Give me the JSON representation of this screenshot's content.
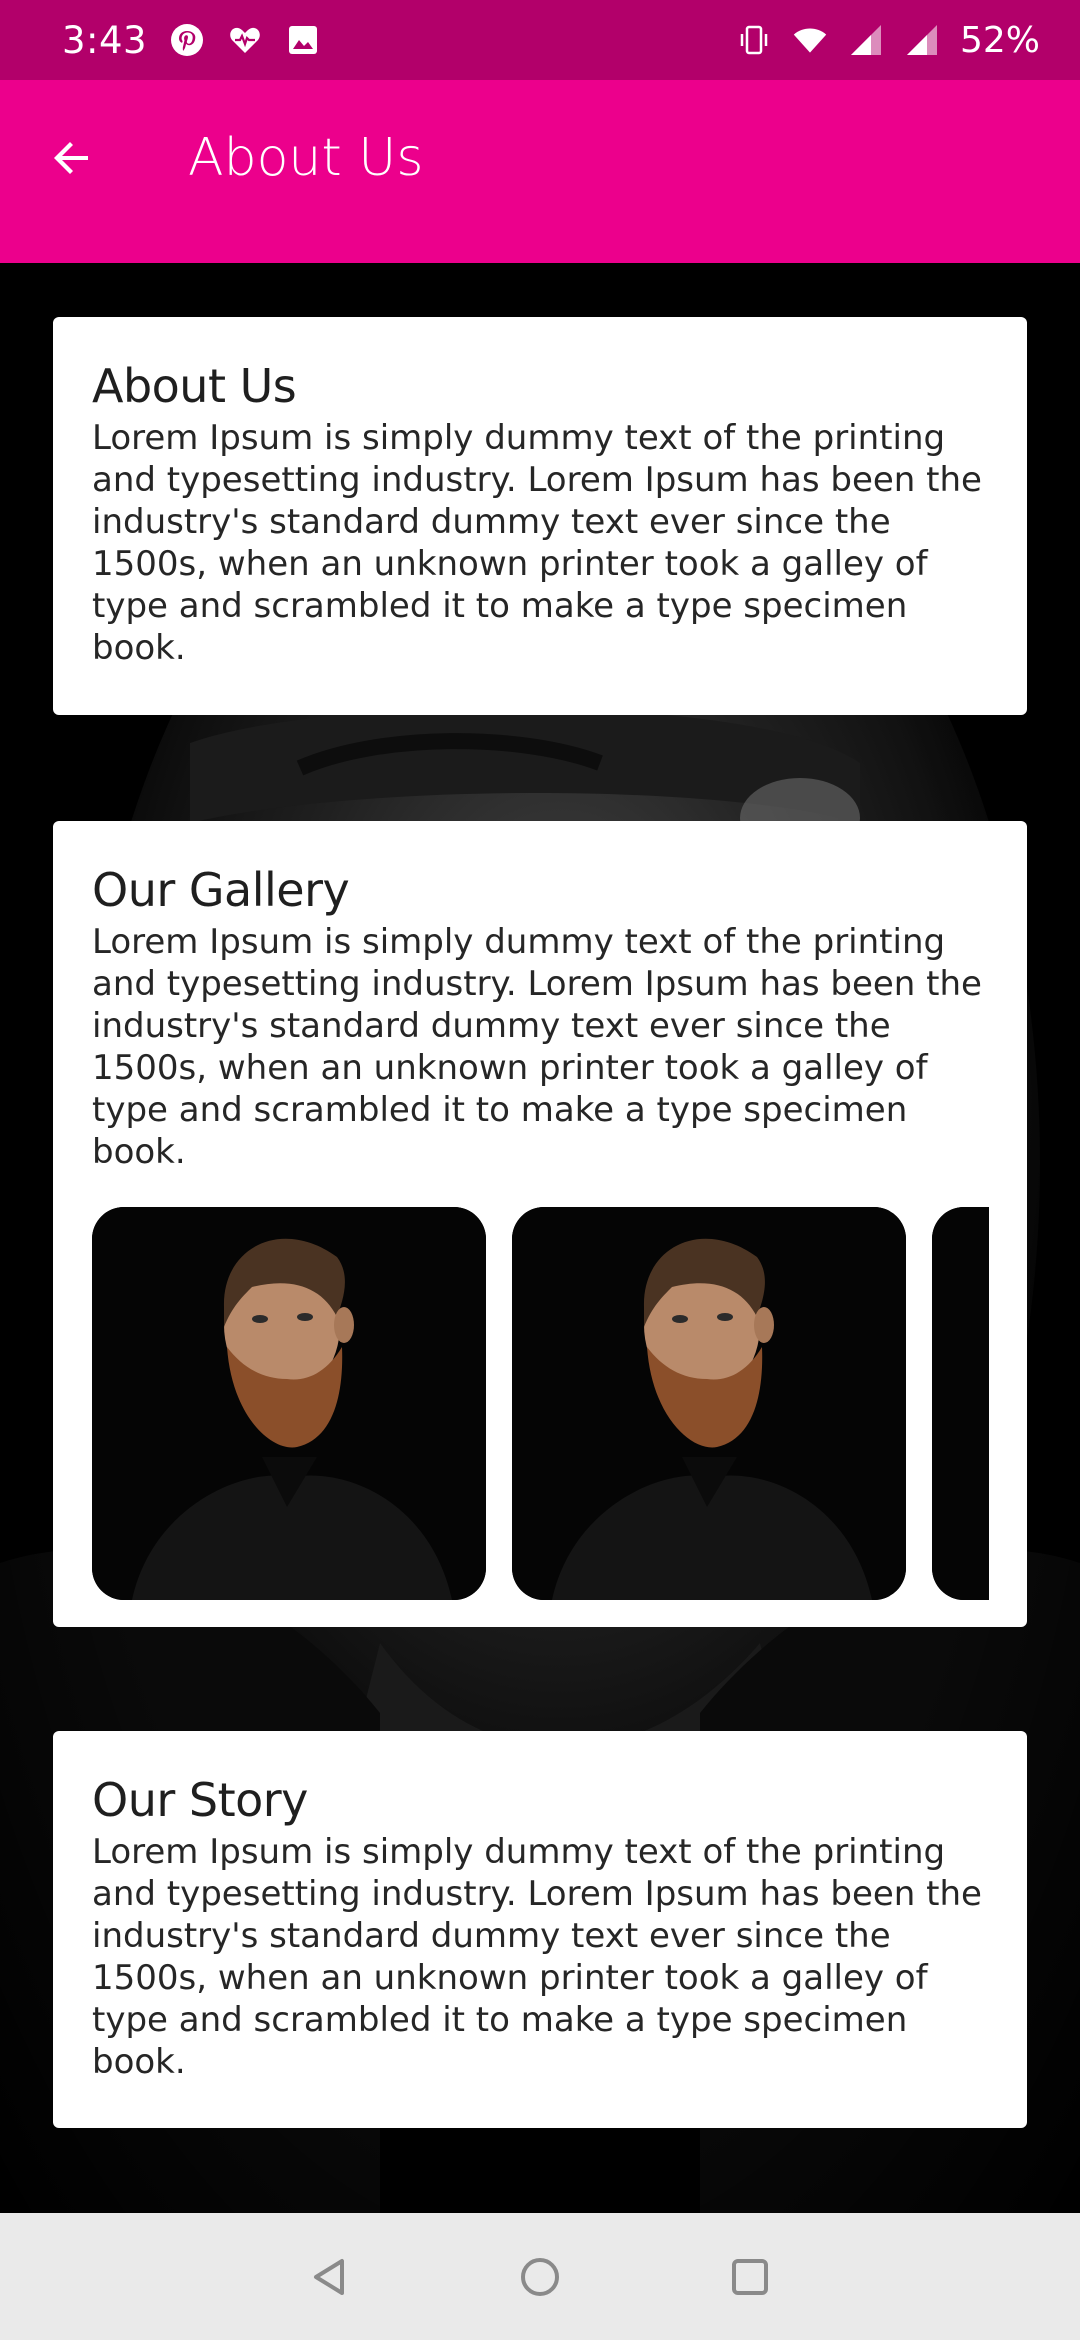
{
  "status_bar": {
    "time": "3:43",
    "left_icons": [
      "pinterest-icon",
      "health-icon",
      "image-icon"
    ],
    "right_icons": [
      "vibrate-icon",
      "wifi-icon",
      "signal-icon",
      "signal-icon"
    ],
    "battery": "52%"
  },
  "app_bar": {
    "title": "About Us",
    "back_icon": "back-arrow-icon"
  },
  "cards": {
    "about": {
      "title": "About Us",
      "body": "Lorem Ipsum is simply dummy text of the printing and typesetting industry. Lorem Ipsum has been the industry's standard dummy text ever since the 1500s, when an unknown printer took a galley of type and scrambled it to make a type specimen book."
    },
    "gallery": {
      "title": "Our Gallery",
      "body": "Lorem Ipsum is simply dummy text of the printing and typesetting industry. Lorem Ipsum has been the industry's standard dummy text ever since the 1500s, when an unknown printer took a galley of type and scrambled it to make a type specimen book.",
      "images": [
        "bearded-man-portrait",
        "bearded-man-portrait",
        "bearded-man-portrait"
      ]
    },
    "story": {
      "title": "Our Story",
      "body": "Lorem Ipsum is simply dummy text of the printing and typesetting industry. Lorem Ipsum has been the industry's standard dummy text ever since the 1500s, when an unknown printer took a galley of type and scrambled it to make a type specimen book."
    }
  },
  "nav_bar": {
    "buttons": [
      "back-triangle-icon",
      "home-circle-icon",
      "recents-square-icon"
    ]
  },
  "colors": {
    "status_bar": "#b2006a",
    "app_bar": "#ec008c",
    "background": "#000000",
    "card": "#ffffff",
    "nav_bar": "#eaeaea"
  }
}
